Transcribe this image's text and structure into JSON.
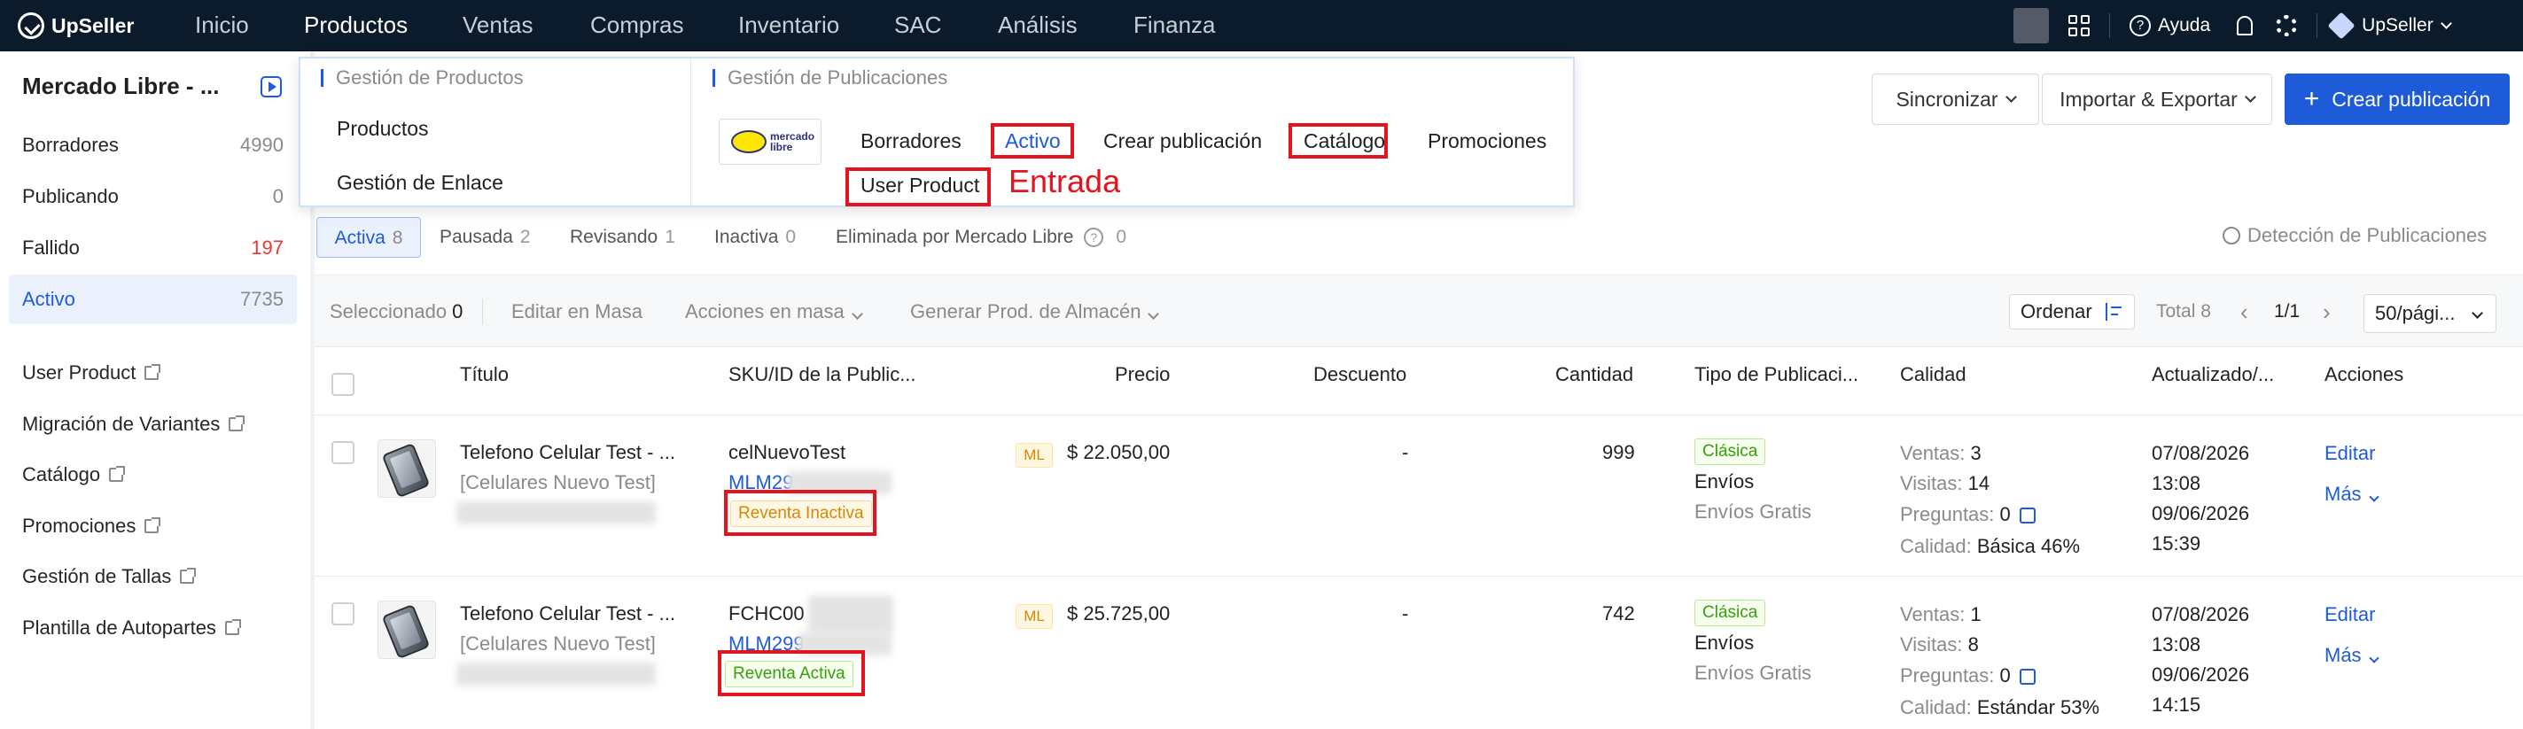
{
  "app": {
    "name": "UpSeller"
  },
  "nav": {
    "items": [
      "Inicio",
      "Productos",
      "Ventas",
      "Compras",
      "Inventario",
      "SAC",
      "Análisis",
      "Finanza"
    ],
    "help": "Ayuda",
    "account": "UpSeller"
  },
  "sidebar": {
    "title": "Mercado Libre - ...",
    "statuses": [
      {
        "label": "Borradores",
        "count": "4990"
      },
      {
        "label": "Publicando",
        "count": "0"
      },
      {
        "label": "Fallido",
        "count": "197"
      },
      {
        "label": "Activo",
        "count": "7735"
      }
    ],
    "links": [
      "User Product",
      "Migración de Variantes",
      "Catálogo",
      "Promociones",
      "Gestión de Tallas",
      "Plantilla de Autopartes"
    ]
  },
  "dropdown": {
    "group1_title": "Gestión de Productos",
    "group1_items": [
      "Productos",
      "Gestión de Enlace"
    ],
    "group2_title": "Gestión de Publicaciones",
    "logo_text": "mercado libre",
    "group2_items": [
      "Borradores",
      "Activo",
      "Crear publicación",
      "Catálogo",
      "Promociones",
      "User Product"
    ],
    "annotation": "Entrada"
  },
  "actions": {
    "sync": "Sincronizar",
    "import_export": "Importar & Exportar",
    "create": "Crear publicación"
  },
  "tabs": [
    {
      "label": "Activa",
      "count": "8"
    },
    {
      "label": "Pausada",
      "count": "2"
    },
    {
      "label": "Revisando",
      "count": "1"
    },
    {
      "label": "Inactiva",
      "count": "0"
    },
    {
      "label": "Eliminada por Mercado Libre",
      "count": "0"
    }
  ],
  "detection": "Detección de Publicaciones",
  "toolbar": {
    "selected_label": "Seleccionado",
    "selected_count": "0",
    "bulk_edit": "Editar en Masa",
    "bulk_actions": "Acciones en masa",
    "generate": "Generar Prod. de Almacén",
    "sort": "Ordenar",
    "total": "Total 8",
    "page": "1/1",
    "per_page": "50/pági..."
  },
  "table": {
    "headers": [
      "Título",
      "SKU/ID de la Public...",
      "Precio",
      "Descuento",
      "Cantidad",
      "Tipo de Publicaci...",
      "Calidad",
      "Actualizado/...",
      "Acciones"
    ],
    "rows": [
      {
        "title": "Telefono Celular Test - ...",
        "category": "[Celulares Nuevo Test]",
        "sku": "celNuevoTest",
        "mlm": "MLM29",
        "status_tag": "Reventa Inactiva",
        "site_tag": "ML",
        "price": "$ 22.050,00",
        "discount": "-",
        "quantity": "999",
        "type_tag": "Clásica",
        "shipping": "Envíos",
        "shipping_sub": "Envíos Gratis",
        "sales_label": "Ventas:",
        "sales": "3",
        "visits_label": "Visitas:",
        "visits": "14",
        "questions_label": "Preguntas:",
        "questions": "0",
        "quality_label": "Calidad:",
        "quality": "Básica 46%",
        "updated_date": "07/08/2026",
        "updated_time": "13:08",
        "created_date": "09/06/2026",
        "created_time": "15:39",
        "edit": "Editar",
        "more": "Más"
      },
      {
        "title": "Telefono Celular Test - ...",
        "category": "[Celulares Nuevo Test]",
        "sku": "FCHC00",
        "mlm": "MLM299",
        "status_tag": "Reventa Activa",
        "site_tag": "ML",
        "price": "$ 25.725,00",
        "discount": "-",
        "quantity": "742",
        "type_tag": "Clásica",
        "shipping": "Envíos",
        "shipping_sub": "Envíos Gratis",
        "sales_label": "Ventas:",
        "sales": "1",
        "visits_label": "Visitas:",
        "visits": "8",
        "questions_label": "Preguntas:",
        "questions": "0",
        "quality_label": "Calidad:",
        "quality": "Estándar 53%",
        "updated_date": "07/08/2026",
        "updated_time": "13:08",
        "created_date": "09/06/2026",
        "created_time": "14:15",
        "edit": "Editar",
        "more": "Más"
      }
    ]
  }
}
